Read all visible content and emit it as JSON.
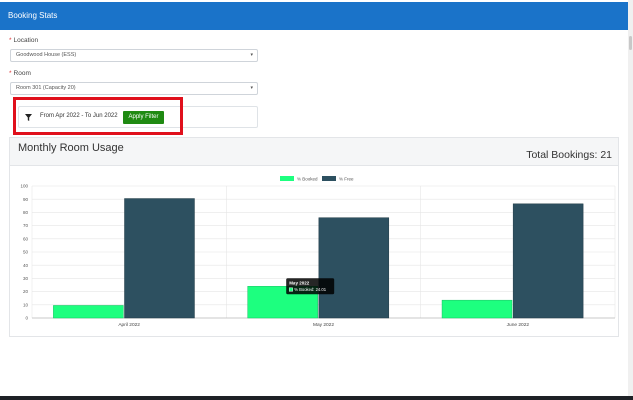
{
  "window": {
    "title": "Booking Stats"
  },
  "form": {
    "location_label": "Location",
    "location_value": "Goodwood House (ESS)",
    "room_label": "Room",
    "room_value": "Room 301 (Capacity 20)",
    "required_marker": "*"
  },
  "filter": {
    "range_text": "From Apr 2022 - To Jun 2022",
    "apply_label": "Apply Filter"
  },
  "panel": {
    "title": "Monthly Room Usage",
    "total_label": "Total Bookings: 21"
  },
  "tooltip": {
    "title": "May 2022",
    "body": "% Booked: 24.01"
  },
  "colors": {
    "header": "#1a73c9",
    "booked": "#1dff7f",
    "free": "#2d5060",
    "apply": "#1f8a12",
    "highlight": "#e0101c"
  },
  "chart_data": {
    "type": "bar",
    "categories": [
      "April 2022",
      "May 2022",
      "June 2022"
    ],
    "series": [
      {
        "name": "% Booked",
        "values": [
          9.5,
          24.01,
          13.5
        ]
      },
      {
        "name": "% Free",
        "values": [
          90.5,
          75.99,
          86.5
        ]
      }
    ],
    "ylim": [
      0,
      100
    ],
    "yticks": [
      0,
      10,
      20,
      30,
      40,
      50,
      60,
      70,
      80,
      90,
      100
    ],
    "legend": "top-center",
    "grid": true
  }
}
